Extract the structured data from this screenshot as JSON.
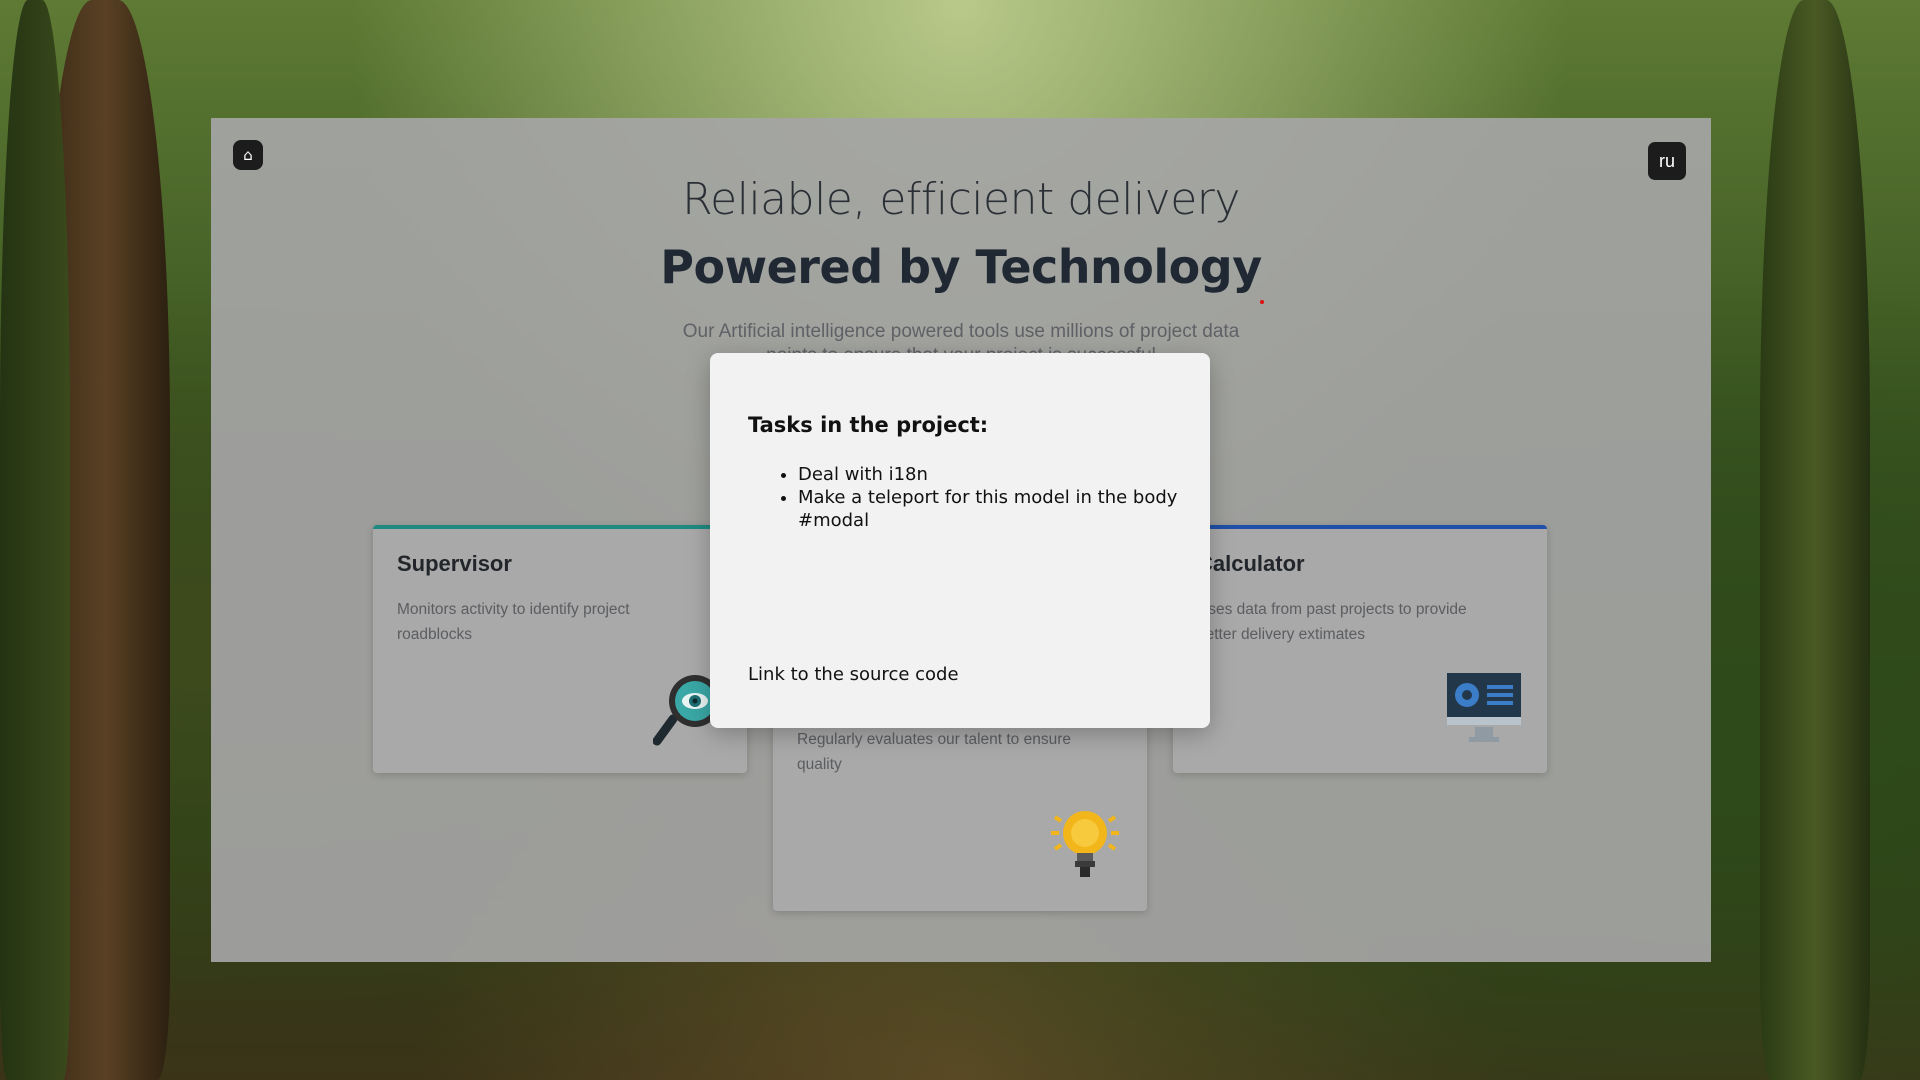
{
  "hero": {
    "subtitle": "Reliable, efficient delivery",
    "title": "Powered by Technology",
    "description": "Our Artificial intelligence powered tools use millions of project data points to ensure that your project is successful"
  },
  "header": {
    "home_icon": "⌂",
    "lang_label": "ru"
  },
  "cards": [
    {
      "title": "Supervisor",
      "description": "Monitors activity to identify project roadblocks",
      "accent": "#1f8a80",
      "icon": "magnifier-eye-icon"
    },
    {
      "title": "Calculator",
      "description": "Uses data from past projects to provide better delivery extimates",
      "accent": "#1f4fa8",
      "icon": "monitor-icon"
    },
    {
      "title": "",
      "description": "Regularly evaluates our talent to ensure quality",
      "accent": "#c8a200",
      "icon": "lightbulb-icon"
    }
  ],
  "modal": {
    "title": "Tasks in the project:",
    "tasks": [
      "Deal with i18n",
      "Make a teleport for this model in the body #modal"
    ],
    "link_label": "Link to the source code"
  }
}
